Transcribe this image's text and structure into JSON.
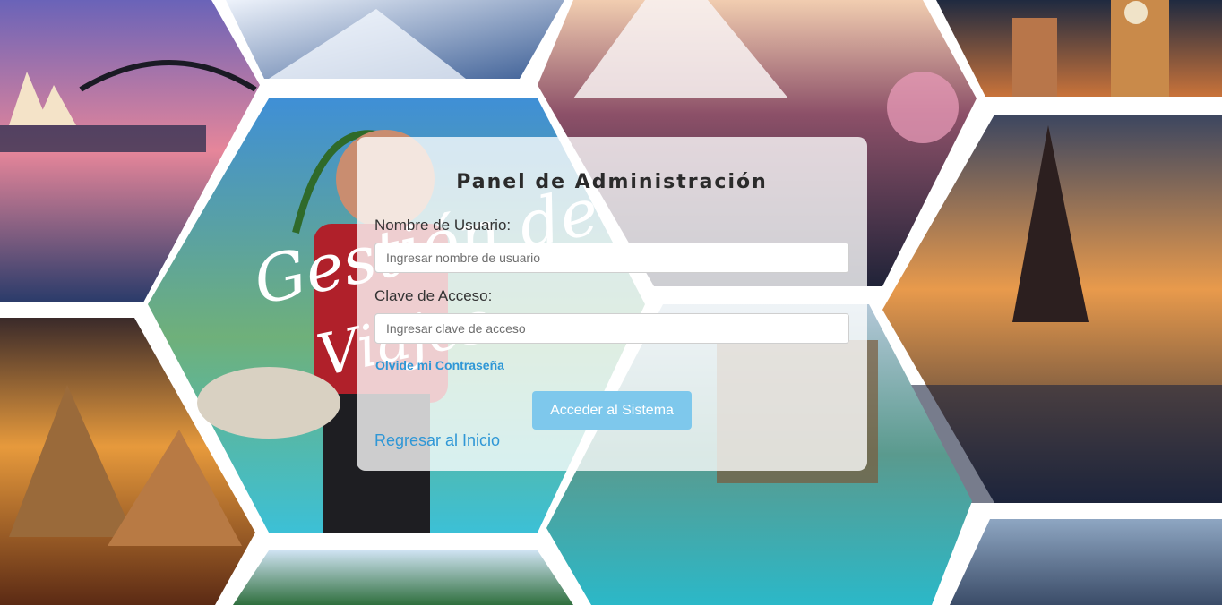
{
  "login": {
    "title": "Panel de Administración",
    "username_label": "Nombre de Usuario:",
    "username_placeholder": "Ingresar nombre de usuario",
    "password_label": "Clave de Acceso:",
    "password_placeholder": "Ingresar clave de acceso",
    "forgot_link": "Olvide mi Contraseña",
    "submit_label": "Acceder al Sistema",
    "back_link": "Regresar al Inicio"
  },
  "background": {
    "logo_text": "Gestión de Viajes"
  },
  "colors": {
    "link": "#2f97d6",
    "button": "#7ec8ec",
    "panel": "#ffffff"
  }
}
